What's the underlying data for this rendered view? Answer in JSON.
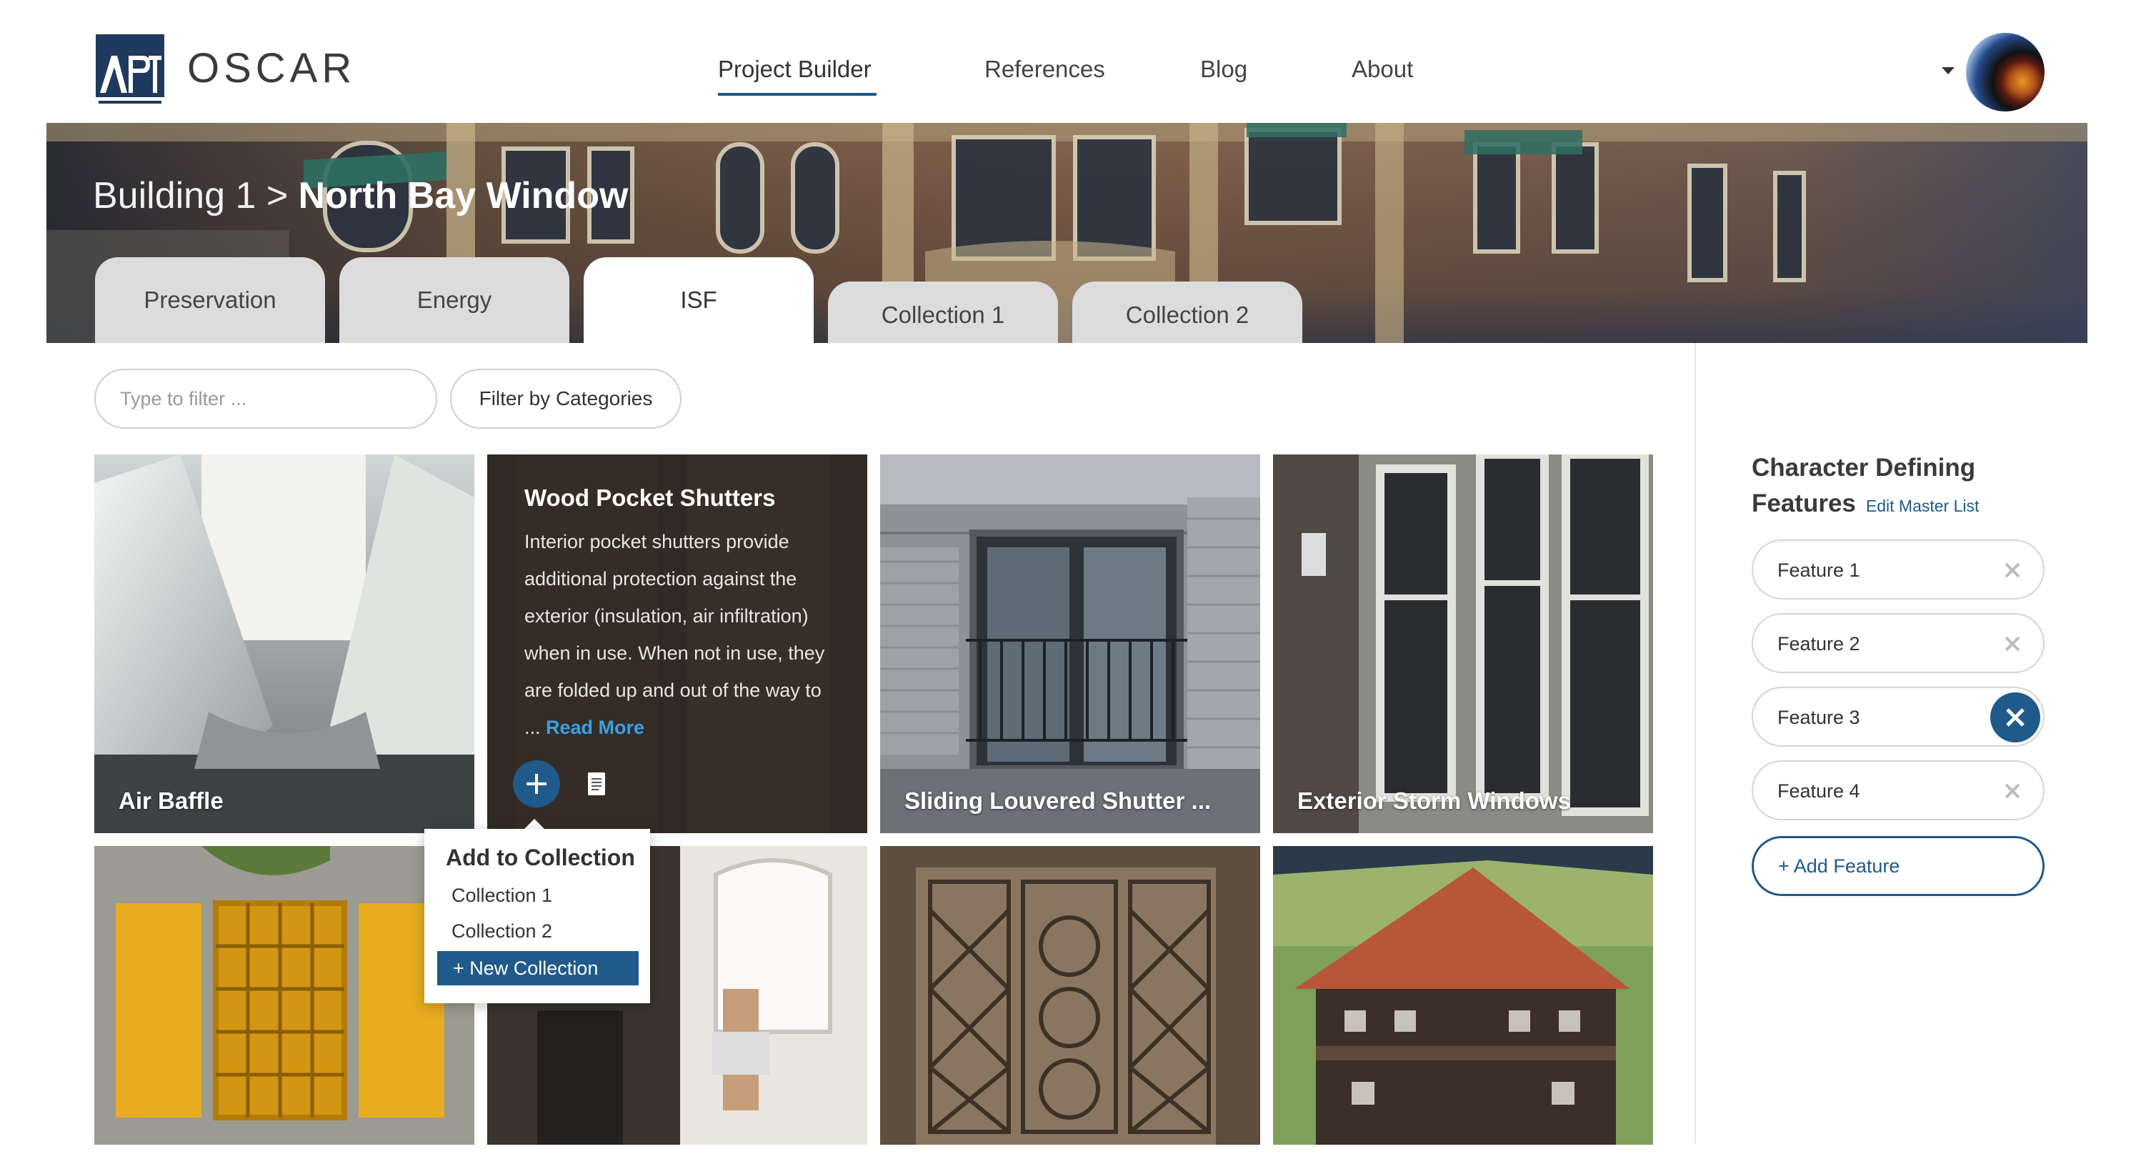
{
  "header": {
    "logo_text": "APT INTERNATIONAL",
    "brand": "OSCAR",
    "nav": [
      {
        "label": "Project  Builder",
        "active": true
      },
      {
        "label": "References",
        "active": false
      },
      {
        "label": "Blog",
        "active": false
      },
      {
        "label": "About",
        "active": false
      }
    ]
  },
  "breadcrumb": {
    "parent": "Building 1",
    "separator": ">",
    "current": "North Bay Window"
  },
  "tabs": [
    {
      "label": "Preservation",
      "active": false
    },
    {
      "label": "Energy",
      "active": false
    },
    {
      "label": "ISF",
      "active": true
    },
    {
      "label": "Collection 1",
      "active": false
    },
    {
      "label": "Collection 2",
      "active": false
    }
  ],
  "filter": {
    "placeholder": "Type to filter ...",
    "categories_label": "Filter by Categories"
  },
  "cards": [
    {
      "title": "Air Baffle"
    },
    {
      "title": "Wood Pocket Shutters",
      "description": "Interior pocket shutters provide additional protection against the exterior (insulation, air infiltration) when in use. When not in use, they are folded up and out of the way to ...",
      "read_more": "Read More"
    },
    {
      "title": "Sliding Louvered Shutter ..."
    },
    {
      "title": "Exterior Storm Windows"
    },
    {
      "title": ""
    },
    {
      "title": ""
    },
    {
      "title": ""
    },
    {
      "title": ""
    }
  ],
  "add_to_collection": {
    "title": "Add to Collection",
    "items": [
      "Collection 1",
      "Collection 2"
    ],
    "new_label": "+ New Collection"
  },
  "sidebar": {
    "title_line1": "Character Defining",
    "title_line2": "Features",
    "edit_link": "Edit Master List",
    "features": [
      {
        "label": "Feature 1",
        "selected": false
      },
      {
        "label": "Feature 2",
        "selected": false
      },
      {
        "label": "Feature 3",
        "selected": true
      },
      {
        "label": "Feature 4",
        "selected": false
      }
    ],
    "add_label": "+ Add Feature"
  },
  "colors": {
    "accent": "#1f5a8a",
    "link": "#3aa0e6",
    "tab_inactive": "#dcdcdc"
  }
}
